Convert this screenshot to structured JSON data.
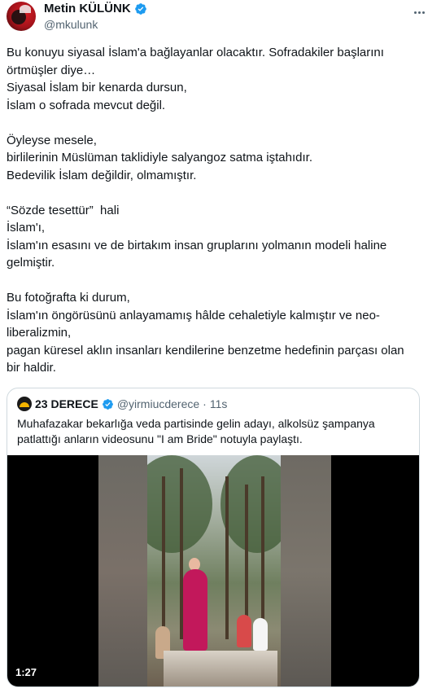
{
  "author": {
    "display_name": "Metin KÜLÜNK",
    "handle": "@mkulunk",
    "verified": true,
    "avatar_icon": "profile-photo"
  },
  "tweet": {
    "text": "Bu konuyu siyasal İslam'a bağlayanlar olacaktır. Sofradakiler başlarını örtmüşler diye…\nSiyasal İslam bir kenarda dursun,\nİslam o sofrada mevcut değil.\n\nÖyleyse mesele,\nbirlilerinin Müslüman taklidiyle salyangoz satma iştahıdır.\nBedevilik İslam değildir, olmamıştır.\n\n“Sözde tesettür”  hali\nİslam'ı,\nİslam'ın esasını ve de birtakım insan gruplarını yolmanın modeli haline gelmiştir.\n\nBu fotoğrafta ki durum,\nİslam'ın öngörüsünü anlayamamış hâlde cehaletiyle kalmıştır ve neo-liberalizmin,\npagan küresel aklın insanları kendilerine benzetme hedefinin parçası olan bir haldir."
  },
  "quoted": {
    "display_name": "23 DERECE",
    "handle": "@yirmiucderece",
    "separator": "·",
    "time": "11s",
    "verified": true,
    "text": "Muhafazakar bekarlığa veda partisinde gelin adayı, alkolsüz şampanya patlattığı anların videosunu \"I am Bride\" notuyla paylaştı.",
    "video": {
      "duration": "1:27"
    }
  },
  "colors": {
    "text_primary": "#0f1419",
    "text_secondary": "#536471",
    "verified_blue": "#1d9bf0",
    "border": "#cfd9de"
  }
}
